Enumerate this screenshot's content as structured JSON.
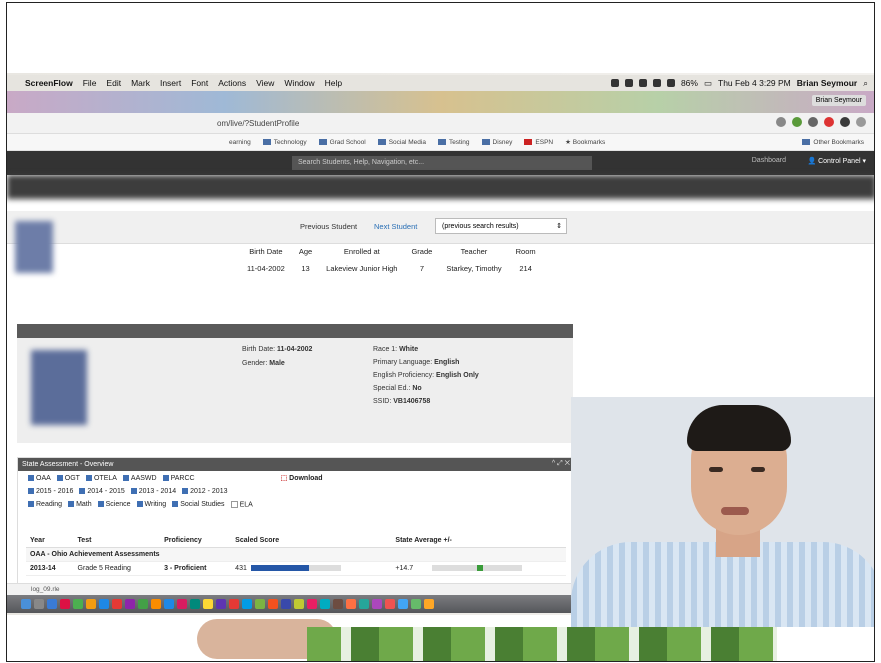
{
  "menubar": {
    "app": "ScreenFlow",
    "items": [
      "File",
      "Edit",
      "Mark",
      "Insert",
      "Font",
      "Actions",
      "View",
      "Window",
      "Help"
    ],
    "battery": "86%",
    "datetime": "Thu Feb 4  3:29 PM",
    "user": "Brian Seymour"
  },
  "browser": {
    "url": "om/live/?StudentProfile",
    "profile_user": "Brian Seymour",
    "bookmarks": [
      "earning",
      "Technology",
      "Grad School",
      "Social Media",
      "Testing",
      "Disney",
      "ESPN",
      "Bookmarks"
    ],
    "other_bookmarks": "Other Bookmarks"
  },
  "appnav": {
    "search_placeholder": "Search Students, Help, Navigation, etc...",
    "dashboard": "Dashboard",
    "control_panel": "Control Panel"
  },
  "studentbar": {
    "previous": "Previous Student",
    "next": "Next Student",
    "results_select": "(previous search results)"
  },
  "summary": {
    "headers": [
      "Birth Date",
      "Age",
      "Enrolled at",
      "Grade",
      "Teacher",
      "Room"
    ],
    "values": [
      "11-04-2002",
      "13",
      "Lakeview Junior High",
      "7",
      "Starkey, Timothy",
      "214"
    ]
  },
  "profile": {
    "birth_date_label": "Birth Date:",
    "birth_date": "11-04-2002",
    "gender_label": "Gender:",
    "gender": "Male",
    "race_label": "Race 1:",
    "race": "White",
    "language_label": "Primary Language:",
    "language": "English",
    "proficiency_label": "English Proficiency:",
    "proficiency": "English Only",
    "special_label": "Special Ed.:",
    "special": "No",
    "ssid_label": "SSID:",
    "ssid": "VB1406758"
  },
  "state_assessment": {
    "title": "State Assessment - Overview",
    "tests": [
      "OAA",
      "OGT",
      "OTELA",
      "AASWD",
      "PARCC"
    ],
    "download": "Download",
    "years": [
      "2015 - 2016",
      "2014 - 2015",
      "2013 - 2014",
      "2012 - 2013"
    ],
    "subjects": [
      "Reading",
      "Math",
      "Science",
      "Writing",
      "Social Studies",
      "ELA"
    ],
    "columns": [
      "Year",
      "Test",
      "Proficiency",
      "Scaled Score",
      "State Average +/-"
    ],
    "group": "OAA - Ohio Achievement Assessments",
    "row": {
      "year": "2013-14",
      "test": "Grade 5 Reading",
      "proficiency": "3 - Proficient",
      "score": "431",
      "score_fraction": 0.65,
      "state_avg": "+14.7",
      "state_avg_fraction": 0.5
    }
  },
  "downloads": {
    "file": "log_09.rle"
  },
  "colors": {
    "dark_nav": "#333333",
    "link": "#2a6fb5",
    "bar": "#2557a7"
  }
}
